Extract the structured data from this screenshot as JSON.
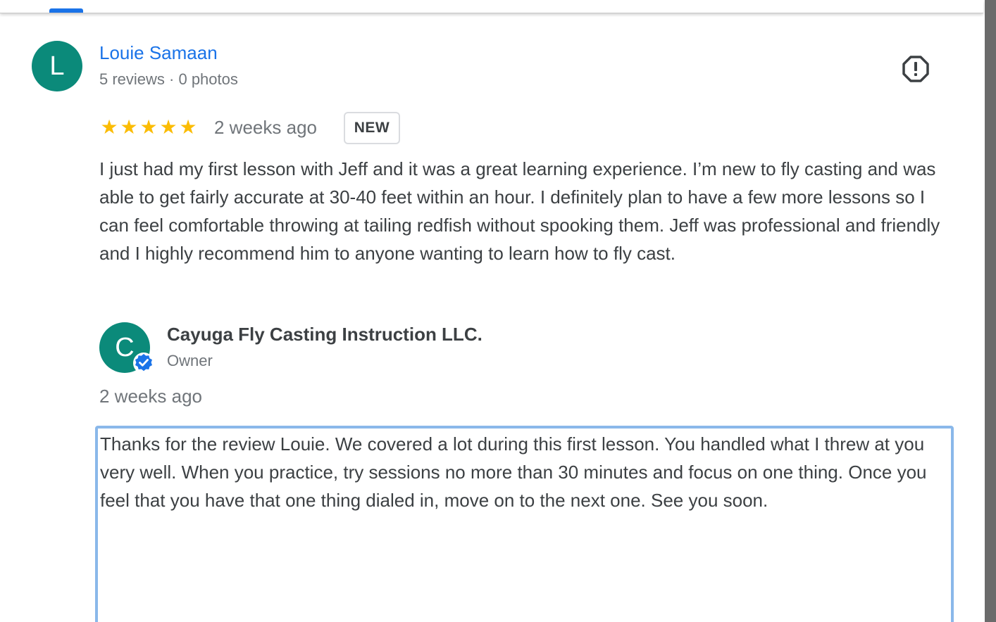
{
  "review": {
    "avatar_letter": "L",
    "reviewer_name": "Louie Samaan",
    "reviewer_meta": "5 reviews · 0 photos",
    "rating": 5,
    "rating_max": 5,
    "time": "2 weeks ago",
    "badge": "NEW",
    "text": "I just had my first lesson with Jeff and it was a great learning experience. I’m new to fly casting and was able to get fairly accurate at 30-40 feet within an hour. I definitely plan to have a few more lessons so I can feel comfortable throwing at tailing redfish without spooking them. Jeff was professional and friendly and I highly recommend him to anyone wanting to learn how to fly cast."
  },
  "reply": {
    "avatar_letter": "C",
    "owner_name": "Cayuga Fly Casting Instruction LLC.",
    "owner_role": "Owner",
    "time": "2 weeks ago",
    "text": "Thanks for the review Louie. We covered a lot during this first lesson. You handled what I threw at you very well. When you practice, try sessions no more than 30 minutes and focus on one thing. Once you feel that you have that one thing dialed in, move on to the next one. See you soon."
  },
  "colors": {
    "accent": "#1a73e8",
    "avatar": "#0b8a7a",
    "star": "#fbbc04",
    "focus_border": "#8ab8ea",
    "secondary_text": "#70757a"
  },
  "icons": {
    "flag": "report-flag-icon",
    "verified": "verified-check-icon",
    "star": "star-icon"
  }
}
